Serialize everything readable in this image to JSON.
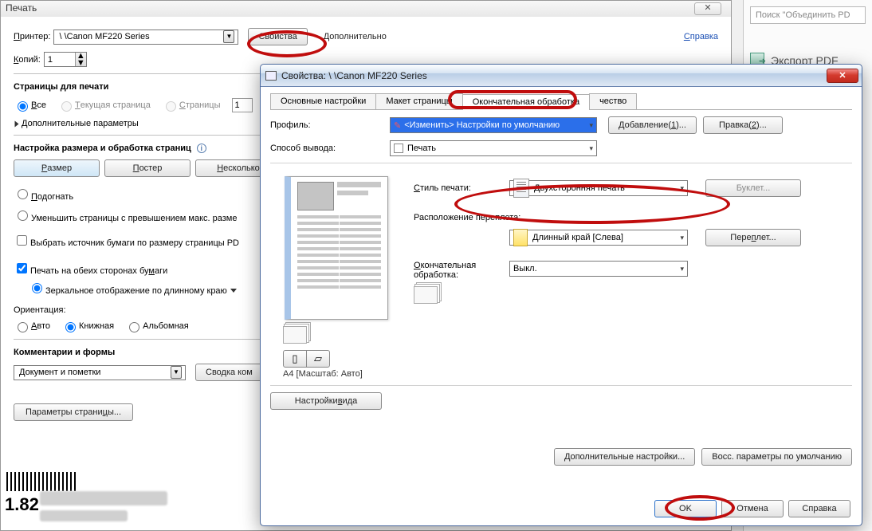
{
  "print": {
    "title": "Печать",
    "printerLabel": "Принтер:",
    "printerValue": "\\    \\Canon MF220 Series",
    "propertiesBtn": "Свойства",
    "advancedBtn": "Дополнительно",
    "helpLink": "Справка",
    "copiesLabel": "Копий:",
    "copiesValue": "1",
    "pagesGroup": "Страницы для печати",
    "radioAll": "Все",
    "radioCurrent": "Текущая страница",
    "radioPages": "Страницы",
    "pagesInput": "1",
    "extraParams": "Дополнительные параметры",
    "sizingGroup": "Настройка размера и обработка страниц",
    "btnSize": "Размер",
    "btnPoster": "Постер",
    "btnMulti": "Несколько",
    "radioFit": "Подогнать",
    "radioShrink": "Уменьшить страницы с превышением макс. разме",
    "chkPaperSource": "Выбрать источник бумаги по размеру страницы PD",
    "chkDuplex": "Печать на обеих сторонах бумаги",
    "radioMirror": "Зеркальное отображение по длинному краю",
    "orientLabel": "Ориентация:",
    "orientAuto": "Авто",
    "orientPortrait": "Книжная",
    "orientLandscape": "Альбомная",
    "commentsGroup": "Комментарии и формы",
    "commentsCombo": "Документ и пометки",
    "summaryBtn": "Сводка ком",
    "pageSetupBtn": "Параметры страницы..."
  },
  "right": {
    "search": "Поиск \"Объединить PD",
    "export": "Экспорт PDF"
  },
  "props": {
    "title": "Свойства: \\        \\Canon MF220 Series",
    "tabs": [
      "Основные настройки",
      "Макет страницы",
      "Окончательная обработка",
      "чество"
    ],
    "profileLabel": "Профиль:",
    "profileValue": "<Изменить> Настройки по умолчанию",
    "addBtn": "Добавление(1)...",
    "editBtn": "Правка(2)...",
    "outputLabel": "Способ вывода:",
    "outputValue": "Печать",
    "styleLabel": "Стиль печати:",
    "styleValue": "Двухсторонняя печать",
    "bookletBtn": "Буклет...",
    "bindingLabel": "Расположение переплета:",
    "bindingValue": "Длинный край [Слева]",
    "bindBtn": "Переплет...",
    "finishLabel": "Окончательная обработка:",
    "finishValue": "Выкл.",
    "previewCaption": "A4 [Масштаб: Авто]",
    "viewSettingsBtn": "Настройки вида",
    "extraSettingsBtn": "Дополнительные настройки...",
    "restoreBtn": "Восс. параметры по умолчанию",
    "okBtn": "OK",
    "cancelBtn": "Отмена",
    "helpBtn": "Справка"
  },
  "bottom": {
    "num": "1.82"
  }
}
